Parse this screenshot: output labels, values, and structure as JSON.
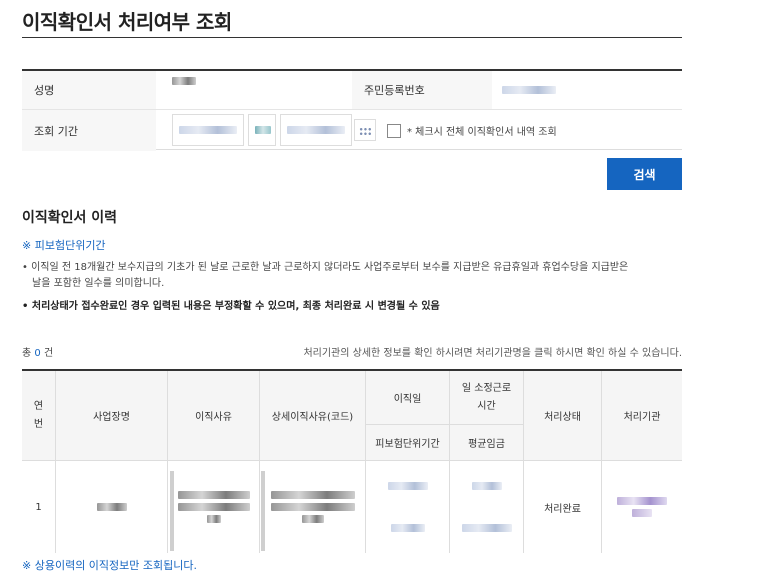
{
  "page": {
    "title": "이직확인서 처리여부 조회"
  },
  "form": {
    "name_label": "성명",
    "rrn_label": "주민등록번호",
    "period_label": "조회 기간",
    "checkbox_label": "* 체크시 전체 이직확인서 내역 조회",
    "search_button": "검색"
  },
  "history": {
    "title": "이직확인서 이력",
    "note_head": "※ 피보험단위기간",
    "note1_line1": "• 이직일 전 18개월간 보수지급의 기초가 된 날로 근로한 날과 근로하지 않더라도 사업주로부터 보수를 지급받은 유급휴일과 휴업수당을 지급받은",
    "note1_line2": "날을 포함한 일수를 의미합니다.",
    "note2": "• 처리상태가 접수완료인 경우 입력된 내용은 부정확할 수 있으며, 최종 처리완료 시 변경될 수 있음",
    "total_prefix": "총",
    "total_count": "0",
    "total_suffix": "건",
    "hint": "처리기관의 상세한 정보를 확인 하시려면 처리기관명을 클릭 하시면 확인 하실 수 있습니다."
  },
  "table": {
    "headers": {
      "seq": "연번",
      "company": "사업장명",
      "reason": "이직사유",
      "detail_reason": "상세이직사유(코드)",
      "leave_date": "이직일",
      "insured_period": "피보험단위기간",
      "work_hours": "일 소정근로시간",
      "avg_wage": "평균임금",
      "status": "처리상태",
      "agency": "처리기관"
    },
    "rows": [
      {
        "seq": "1",
        "status": "처리완료"
      }
    ]
  },
  "footer": {
    "note": "※ 상용이력의 이직정보만 조회됩니다."
  },
  "colors": {
    "accent": "#1565c0",
    "header_bg": "#f5f5f5",
    "border": "#333333"
  },
  "icons": {
    "calendar": "calendar-icon",
    "checkbox": "checkbox-icon"
  }
}
